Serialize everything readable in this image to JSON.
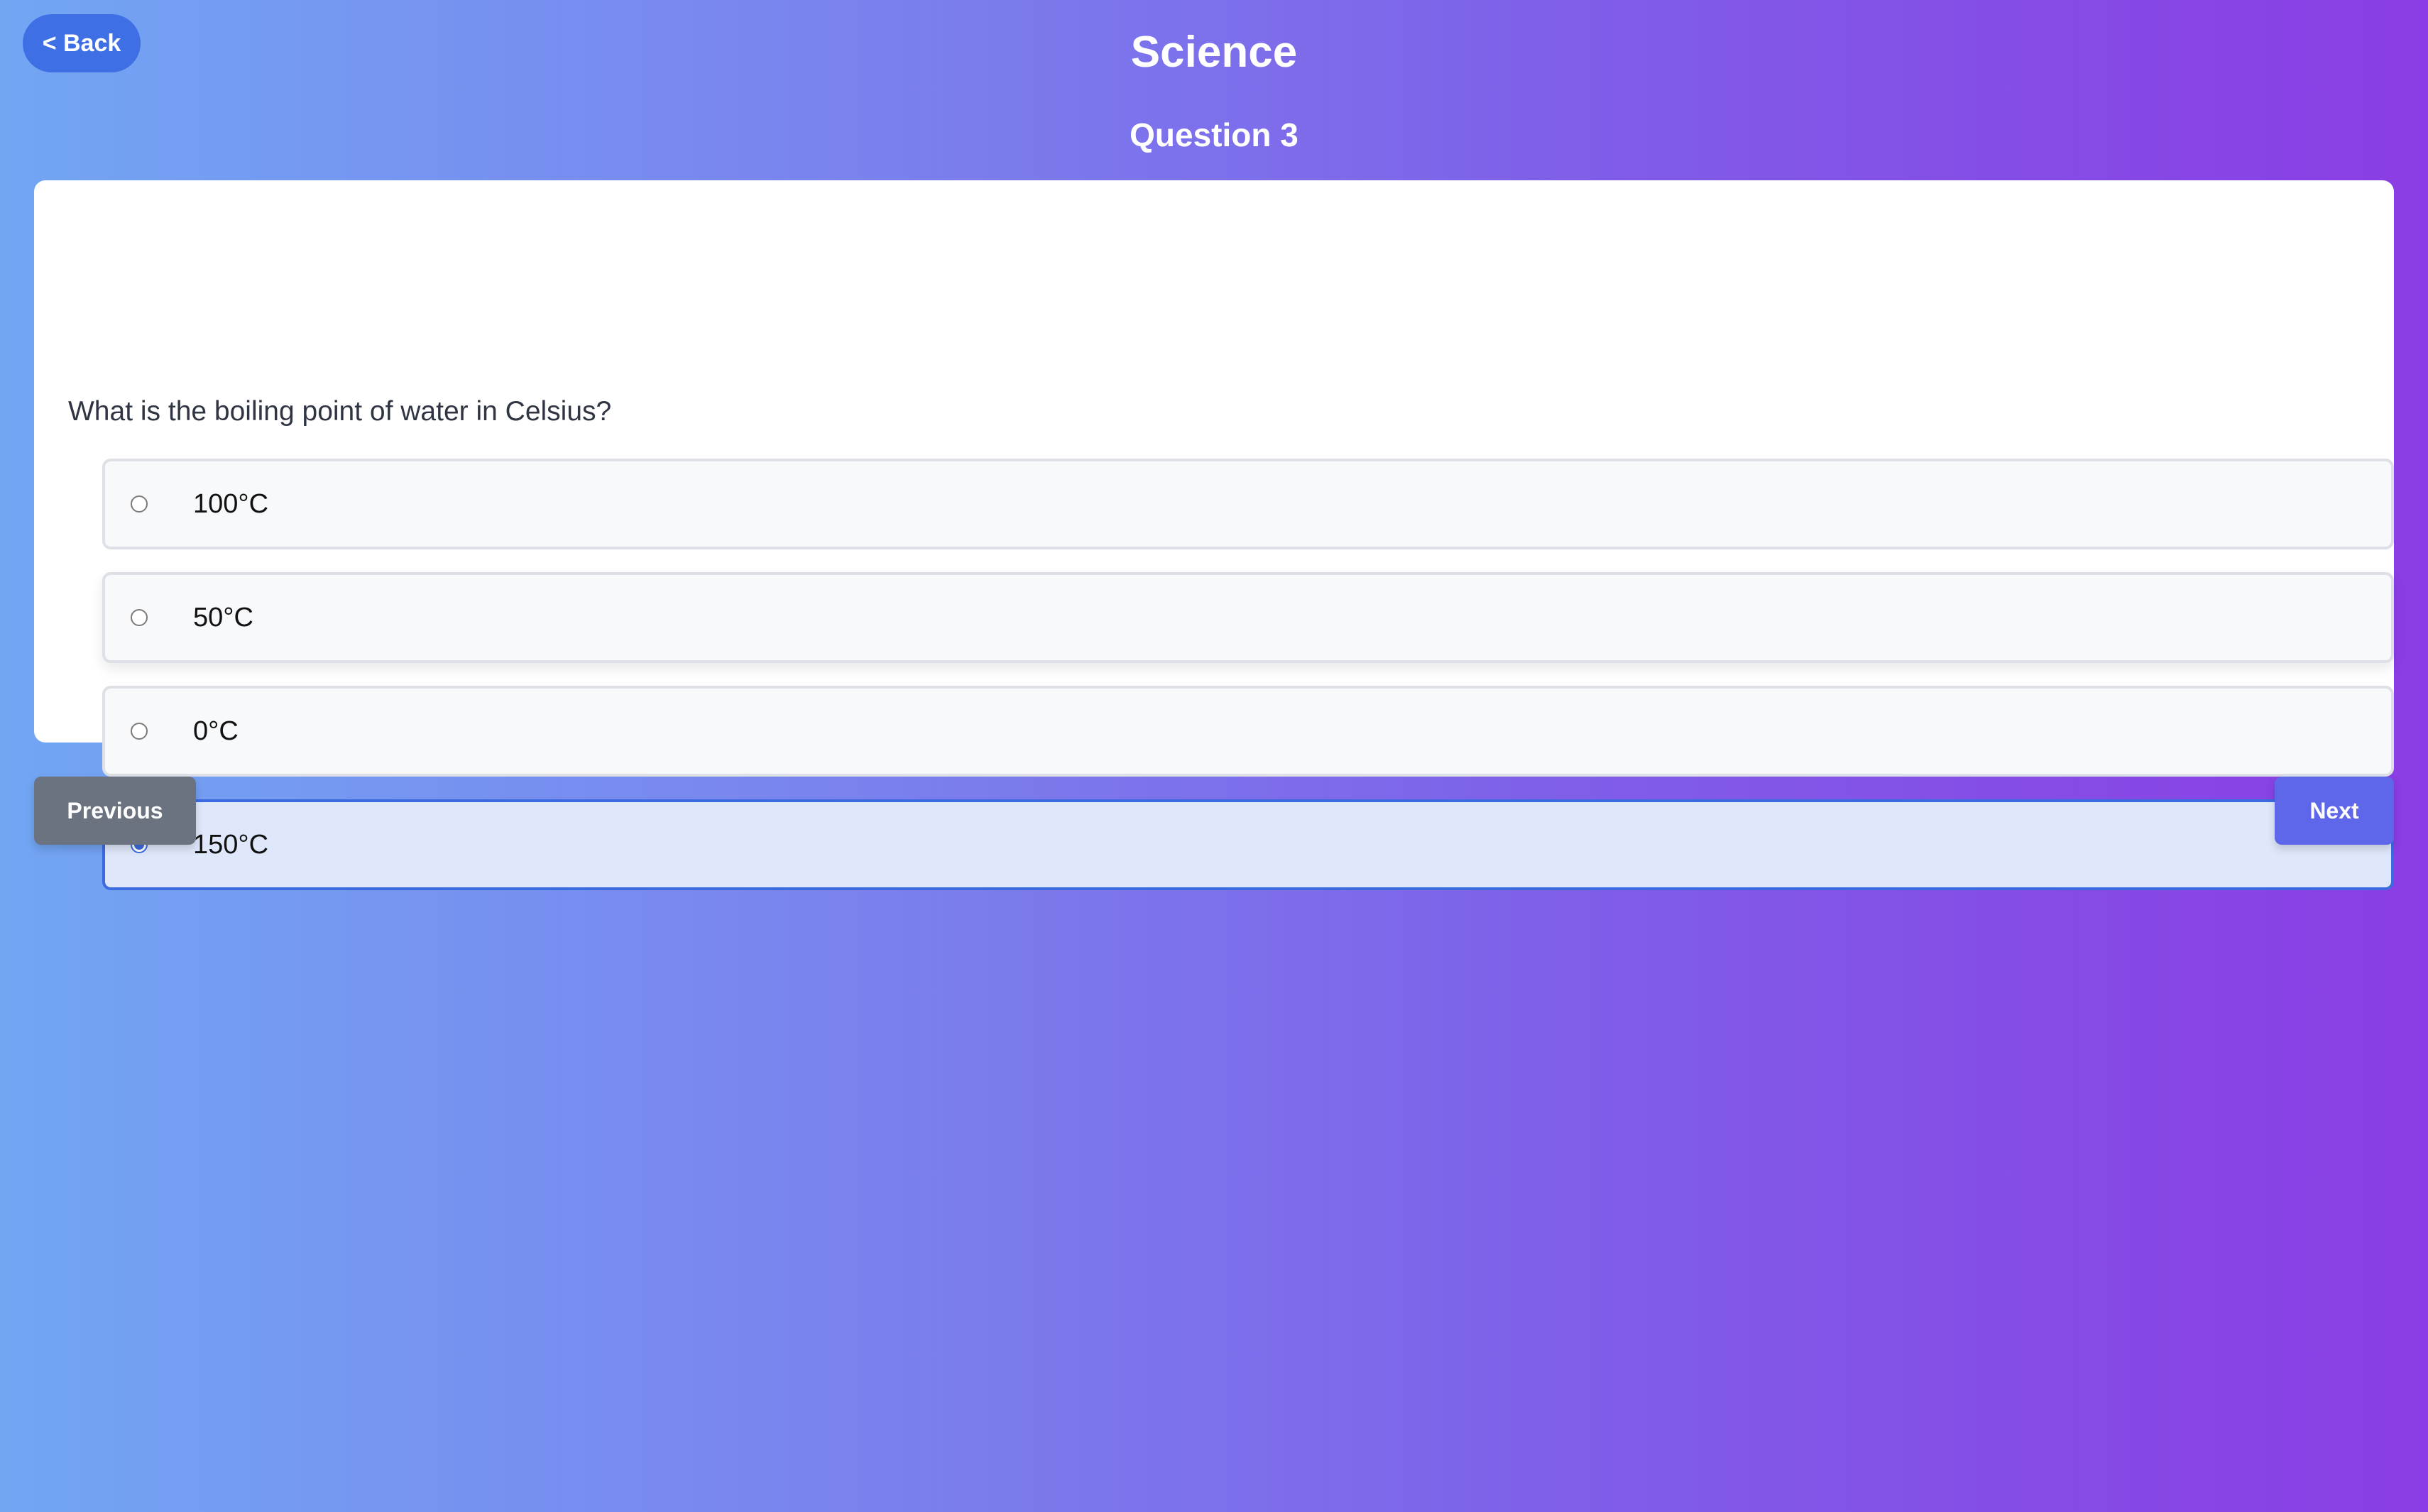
{
  "header": {
    "back_label": "< Back",
    "title": "Science",
    "question_number": "Question 3"
  },
  "question": {
    "text": "What is the boiling point of water in Celsius?",
    "options": [
      {
        "label": "100°C",
        "selected": false
      },
      {
        "label": "50°C",
        "selected": false
      },
      {
        "label": "0°C",
        "selected": false
      },
      {
        "label": "150°C",
        "selected": true
      }
    ]
  },
  "navigation": {
    "previous_label": "Previous",
    "next_label": "Next"
  },
  "colors": {
    "background_start": "#72a6f3",
    "background_end": "#8a3de4",
    "back_button": "#3e6fe5",
    "selected_accent": "#3c6be0",
    "selected_fill": "#dfe8fb",
    "previous_button": "#6b7280",
    "next_button": "#5e66ea"
  }
}
